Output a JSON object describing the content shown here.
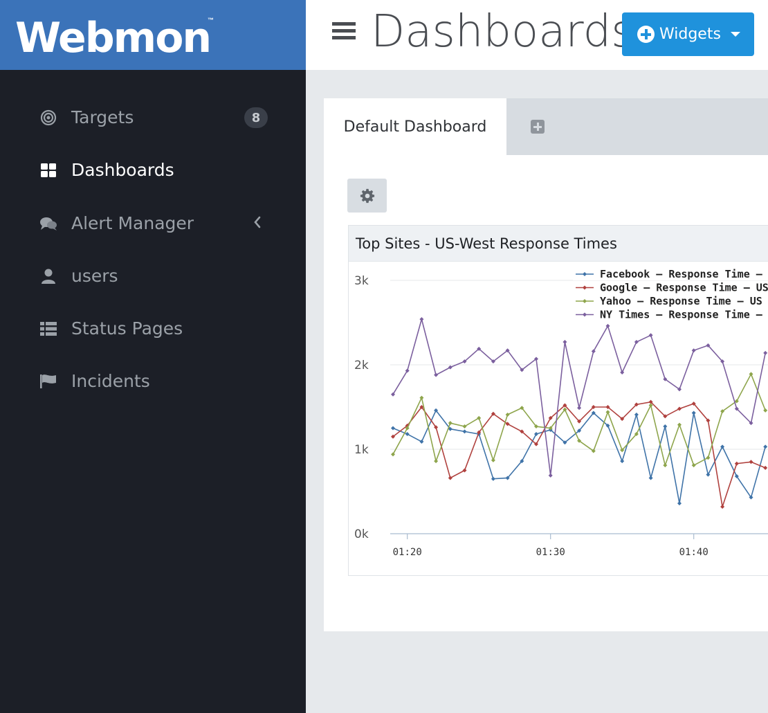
{
  "brand": {
    "name": "Webmon",
    "tm": "™"
  },
  "sidebar": {
    "items": [
      {
        "label": "Targets",
        "icon": "target-icon",
        "badge": "8",
        "active": false
      },
      {
        "label": "Dashboards",
        "icon": "dashboard-grid-icon",
        "active": true
      },
      {
        "label": "Alert Manager",
        "icon": "comments-icon",
        "active": false,
        "has_chevron": true
      },
      {
        "label": "users",
        "icon": "user-icon",
        "active": false
      },
      {
        "label": "Status Pages",
        "icon": "list-icon",
        "active": false
      },
      {
        "label": "Incidents",
        "icon": "flag-icon",
        "active": false
      }
    ]
  },
  "header": {
    "title": "Dashboards",
    "widgets_label": "Widgets"
  },
  "tabs": {
    "active_label": "Default Dashboard"
  },
  "widget": {
    "title": "Top Sites - US-West Response Times"
  },
  "colors": {
    "sidebar_bg": "#1c1f27",
    "brand_bg": "#3b73b9",
    "button_blue": "#1f92dc"
  },
  "chart_data": {
    "type": "line",
    "ylim": [
      0,
      3000
    ],
    "y_ticks": [
      "0k",
      "1k",
      "2k",
      "3k"
    ],
    "x_ticks": [
      "01:20",
      "01:30",
      "01:40"
    ],
    "legend_position": "top-right",
    "series": [
      {
        "name": "Facebook – Response Time –",
        "color": "#3f73a8",
        "values": [
          1250,
          1180,
          1090,
          1460,
          1240,
          1210,
          1180,
          650,
          660,
          860,
          1180,
          1230,
          1080,
          1220,
          1430,
          1280,
          860,
          1410,
          660,
          1270,
          360,
          1430,
          700,
          1030,
          680,
          430,
          1030
        ]
      },
      {
        "name": "Google – Response Time – US",
        "color": "#b0413e",
        "values": [
          1150,
          1280,
          1500,
          1260,
          660,
          750,
          1200,
          1420,
          1300,
          1210,
          1060,
          1370,
          1520,
          1330,
          1500,
          1500,
          1360,
          1530,
          1560,
          1390,
          1480,
          1540,
          1340,
          320,
          830,
          850,
          780
        ]
      },
      {
        "name": "Yahoo – Response Time – US",
        "color": "#8ea54c",
        "values": [
          940,
          1250,
          1610,
          860,
          1310,
          1270,
          1370,
          870,
          1410,
          1490,
          1270,
          1250,
          1470,
          1100,
          980,
          1440,
          990,
          1180,
          1520,
          810,
          1290,
          810,
          900,
          1450,
          1570,
          1890,
          1460
        ]
      },
      {
        "name": "NY Times – Response Time –",
        "color": "#7b5f9e",
        "values": [
          1650,
          1930,
          2540,
          1880,
          1970,
          2040,
          2190,
          2040,
          2170,
          1940,
          2070,
          690,
          2270,
          1490,
          2160,
          2460,
          1910,
          2270,
          2350,
          1830,
          1710,
          2170,
          2230,
          2040,
          1480,
          1310,
          2140
        ]
      }
    ]
  }
}
